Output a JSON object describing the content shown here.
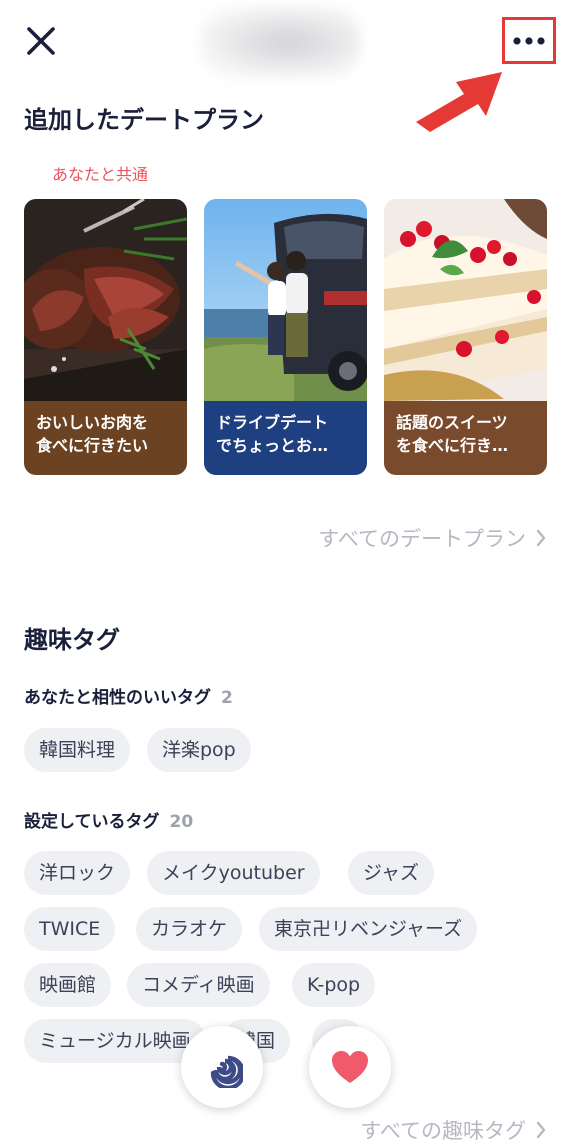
{
  "header": {
    "close_icon": "close-icon",
    "menu_icon": "more-horizontal-icon"
  },
  "annotation": {
    "color": "#e53935"
  },
  "date_plans": {
    "title": "追加したデートプラン",
    "common_label": "あなたと共通",
    "cards": [
      {
        "line1": "おいしいお肉を",
        "line2": "食べに行きたい",
        "caption_color": "#6b4322"
      },
      {
        "line1": "ドライブデート",
        "line2": "でちょっとお…",
        "caption_color": "#1e3f80"
      },
      {
        "line1": "話題のスイーツ",
        "line2": "を食べに行き…",
        "caption_color": "#7a4a2c"
      }
    ],
    "see_all": "すべてのデートプラン"
  },
  "interests": {
    "title": "趣味タグ",
    "compatible": {
      "label": "あなたと相性のいいタグ",
      "count": "2",
      "tags": [
        "韓国料理",
        "洋楽pop"
      ]
    },
    "set": {
      "label": "設定しているタグ",
      "count": "20",
      "tags": [
        "洋ロック",
        "メイクyoutuber",
        "ジャズ",
        "TWICE",
        "カラオケ",
        "東京卍リベンジャーズ",
        "映画館",
        "コメディ映画",
        "K-pop",
        "ミュージカル映画",
        "韓国"
      ]
    },
    "see_all": "すべての趣味タグ"
  },
  "actions": {
    "skip_icon": "spiral-icon",
    "like_icon": "heart-icon",
    "like_color": "#ef5b6b",
    "skip_color": "#3e4b86"
  }
}
